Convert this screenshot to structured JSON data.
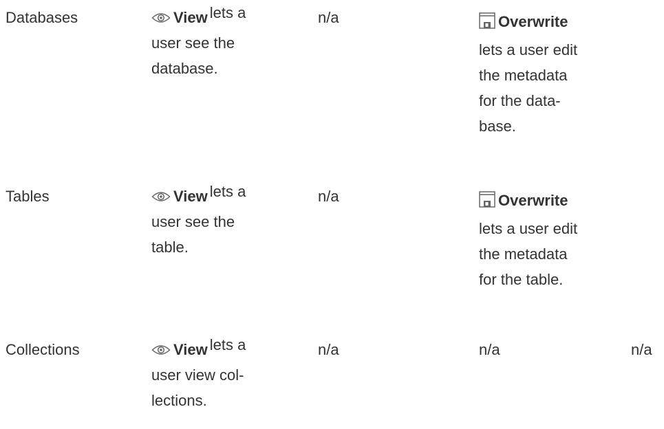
{
  "rows": [
    {
      "content_type": "Databases",
      "view": {
        "label": "View",
        "lead": "lets a",
        "lines": [
          "user see the",
          "database."
        ]
      },
      "col3": "n/a",
      "overwrite": {
        "label": "Overwrite",
        "lines": [
          "lets a user edit",
          "the metadata",
          "for the data-",
          "base."
        ]
      }
    },
    {
      "content_type": "Tables",
      "view": {
        "label": "View",
        "lead": "lets a",
        "lines": [
          "user see the",
          "table."
        ]
      },
      "col3": "n/a",
      "overwrite": {
        "label": "Overwrite",
        "lines": [
          "lets a user edit",
          "the metadata",
          "for the table."
        ]
      }
    },
    {
      "content_type": "Collections",
      "view": {
        "label": "View",
        "lead": "lets a",
        "lines": [
          "user view col-",
          "lections."
        ]
      },
      "col3": "n/a",
      "col4": "n/a",
      "col5": "n/a"
    }
  ],
  "icons": {
    "view": "eye-icon",
    "overwrite": "save-icon"
  }
}
